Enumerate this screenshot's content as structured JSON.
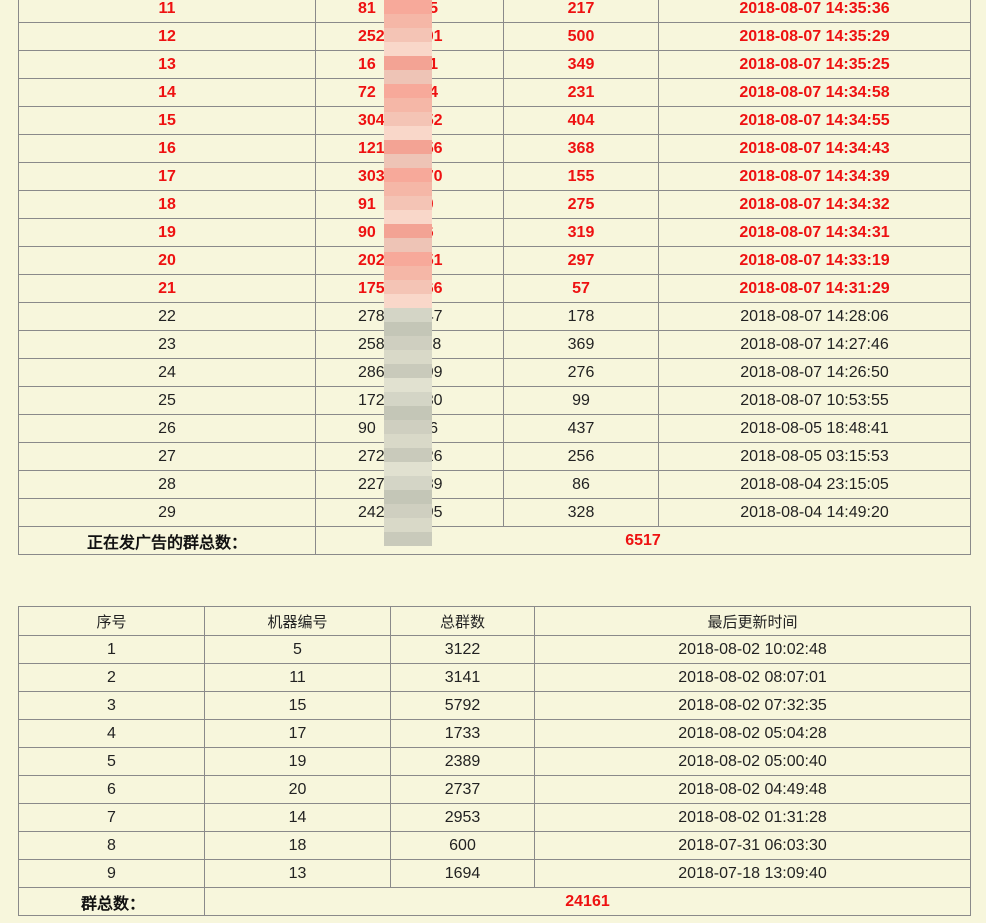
{
  "ad_groups": {
    "rows": [
      {
        "no": "11",
        "account": "81        495",
        "count": "217",
        "time": "2018-08-07 14:35:36",
        "highlight": true
      },
      {
        "no": "12",
        "account": "252       591",
        "count": "500",
        "time": "2018-08-07 14:35:29",
        "highlight": true
      },
      {
        "no": "13",
        "account": "16        551",
        "count": "349",
        "time": "2018-08-07 14:35:25",
        "highlight": true
      },
      {
        "no": "14",
        "account": "72        794",
        "count": "231",
        "time": "2018-08-07 14:34:58",
        "highlight": true
      },
      {
        "no": "15",
        "account": "304       452",
        "count": "404",
        "time": "2018-08-07 14:34:55",
        "highlight": true
      },
      {
        "no": "16",
        "account": "121       356",
        "count": "368",
        "time": "2018-08-07 14:34:43",
        "highlight": true
      },
      {
        "no": "17",
        "account": "303       570",
        "count": "155",
        "time": "2018-08-07 14:34:39",
        "highlight": true
      },
      {
        "no": "18",
        "account": "91         10",
        "count": "275",
        "time": "2018-08-07 14:34:32",
        "highlight": true
      },
      {
        "no": "19",
        "account": "90         36",
        "count": "319",
        "time": "2018-08-07 14:34:31",
        "highlight": true
      },
      {
        "no": "20",
        "account": "202       551",
        "count": "297",
        "time": "2018-08-07 14:33:19",
        "highlight": true
      },
      {
        "no": "21",
        "account": "175       666",
        "count": "57",
        "time": "2018-08-07 14:31:29",
        "highlight": true
      },
      {
        "no": "22",
        "account": "278       047",
        "count": "178",
        "time": "2018-08-07 14:28:06",
        "highlight": false
      },
      {
        "no": "23",
        "account": "258       118",
        "count": "369",
        "time": "2018-08-07 14:27:46",
        "highlight": false
      },
      {
        "no": "24",
        "account": "286       399",
        "count": "276",
        "time": "2018-08-07 14:26:50",
        "highlight": false
      },
      {
        "no": "25",
        "account": "172       930",
        "count": "99",
        "time": "2018-08-07 10:53:55",
        "highlight": false
      },
      {
        "no": "26",
        "account": "90        536",
        "count": "437",
        "time": "2018-08-05 18:48:41",
        "highlight": false
      },
      {
        "no": "27",
        "account": "272       526",
        "count": "256",
        "time": "2018-08-05 03:15:53",
        "highlight": false
      },
      {
        "no": "28",
        "account": "227       489",
        "count": "86",
        "time": "2018-08-04 23:15:05",
        "highlight": false
      },
      {
        "no": "29",
        "account": "242       195",
        "count": "328",
        "time": "2018-08-04 14:49:20",
        "highlight": false
      }
    ],
    "total_label": "正在发广告的群总数：",
    "total_value": "6517"
  },
  "machines": {
    "headers": {
      "no": "序号",
      "machine_id": "机器编号",
      "group_count": "总群数",
      "last_update": "最后更新时间"
    },
    "rows": [
      {
        "no": "1",
        "machine_id": "5",
        "group_count": "3122",
        "last_update": "2018-08-02 10:02:48"
      },
      {
        "no": "2",
        "machine_id": "11",
        "group_count": "3141",
        "last_update": "2018-08-02 08:07:01"
      },
      {
        "no": "3",
        "machine_id": "15",
        "group_count": "5792",
        "last_update": "2018-08-02 07:32:35"
      },
      {
        "no": "4",
        "machine_id": "17",
        "group_count": "1733",
        "last_update": "2018-08-02 05:04:28"
      },
      {
        "no": "5",
        "machine_id": "19",
        "group_count": "2389",
        "last_update": "2018-08-02 05:00:40"
      },
      {
        "no": "6",
        "machine_id": "20",
        "group_count": "2737",
        "last_update": "2018-08-02 04:49:48"
      },
      {
        "no": "7",
        "machine_id": "14",
        "group_count": "2953",
        "last_update": "2018-08-02 01:31:28"
      },
      {
        "no": "8",
        "machine_id": "18",
        "group_count": "600",
        "last_update": "2018-07-31 06:03:30"
      },
      {
        "no": "9",
        "machine_id": "13",
        "group_count": "1694",
        "last_update": "2018-07-18 13:09:40"
      }
    ],
    "total_label": "群总数：",
    "total_value": "24161"
  },
  "colors": {
    "background": "#f7f6dc",
    "highlight_text": "#ee1111",
    "border": "#8a8a8a"
  }
}
